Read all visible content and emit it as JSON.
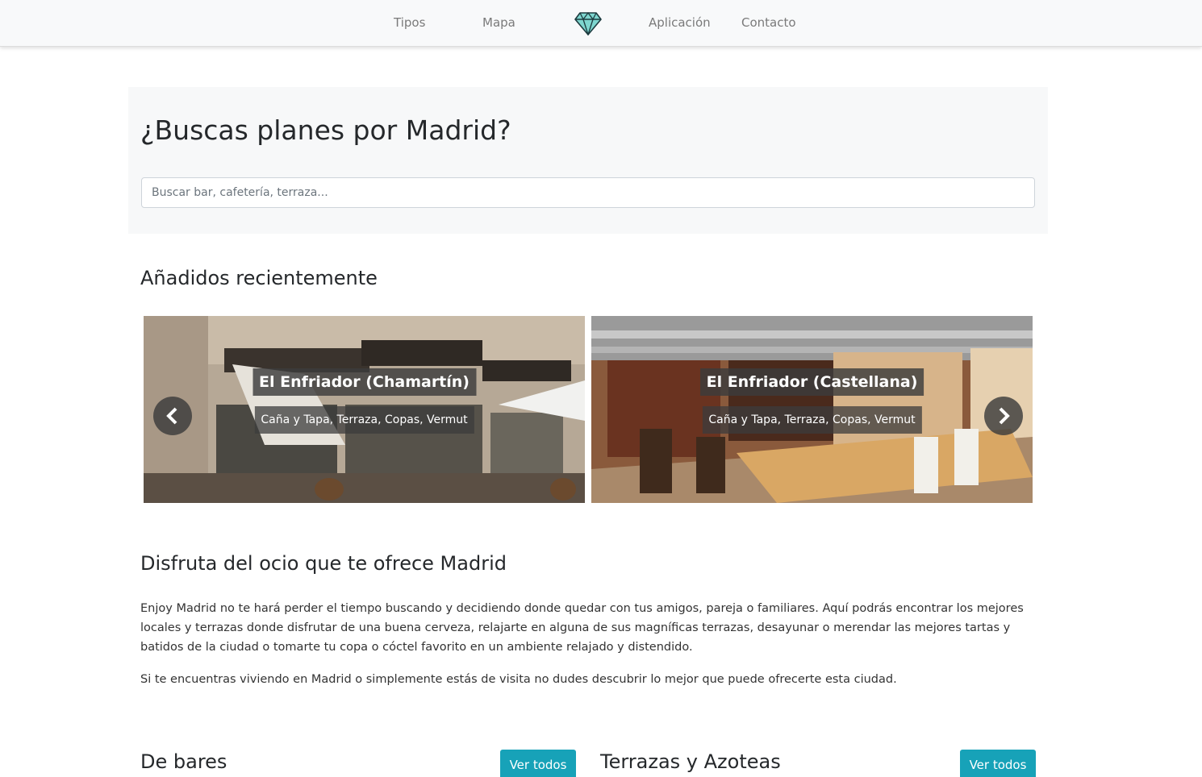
{
  "nav": {
    "items": [
      "Tipos",
      "Mapa",
      "Aplicación",
      "Contacto"
    ],
    "logo_icon": "diamond-icon"
  },
  "hero": {
    "title": "¿Buscas planes por Madrid?",
    "search_placeholder": "Buscar bar, cafetería, terraza..."
  },
  "recent": {
    "title": "Añadidos recientemente",
    "slides": [
      {
        "name": "El Enfriador (Chamartín)",
        "tags": "Caña y Tapa, Terraza, Copas, Vermut"
      },
      {
        "name": "El Enfriador (Castellana)",
        "tags": "Caña y Tapa, Terraza, Copas, Vermut"
      }
    ],
    "prev_icon": "chevron-left-icon",
    "next_icon": "chevron-right-icon"
  },
  "about": {
    "title": "Disfruta del ocio que te ofrece Madrid",
    "paragraphs": [
      "Enjoy Madrid no te hará perder el tiempo buscando y decidiendo donde quedar con tus amigos, pareja o familiares. Aquí podrás encontrar los mejores locales y terrazas donde disfrutar de una buena cerveza, relajarte en alguna de sus magníficas terrazas, desayunar o merendar las mejores tartas y batidos de la ciudad o tomarte tu copa o cóctel favorito en un ambiente relajado y distendido.",
      "Si te encuentras viviendo en Madrid o simplemente estás de visita no dudes descubrir lo mejor que puede ofrecerte esta ciudad."
    ]
  },
  "categories": [
    {
      "title": "De bares",
      "button": "Ver todos"
    },
    {
      "title": "Terrazas y Azoteas",
      "button": "Ver todos"
    }
  ],
  "colors": {
    "accent": "#17a2b8",
    "logo": "#5ec8c0"
  }
}
